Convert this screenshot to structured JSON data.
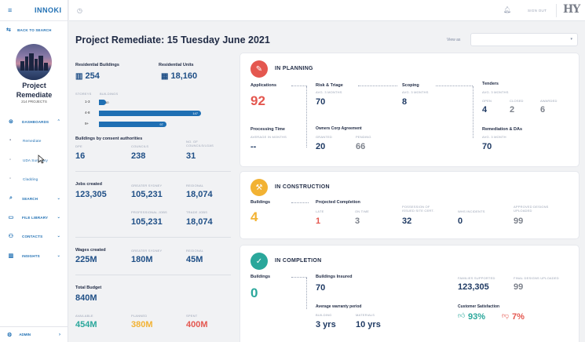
{
  "sidebar": {
    "logo_text": "INNOKI",
    "back_label": "BACK TO SEARCH",
    "project_name_line1": "Project",
    "project_name_line2": "Remediate",
    "project_count": "214 PROJECTS",
    "items": [
      {
        "label": "DASHBOARDS",
        "icon": "dashboard-icon"
      },
      {
        "label": "Remediate"
      },
      {
        "label": "UDA Summary"
      },
      {
        "label": "Cladding"
      },
      {
        "label": "SEARCH",
        "icon": "search-icon"
      },
      {
        "label": "FILE LIBRARY",
        "icon": "folder-icon"
      },
      {
        "label": "CONTACTS",
        "icon": "user-icon"
      },
      {
        "label": "INSIGHTS",
        "icon": "chart-icon"
      }
    ],
    "admin_label": "ADMIN"
  },
  "topbar": {
    "signout_label": "SIGN OUT",
    "brand_mark": "HY"
  },
  "header": {
    "title": "Project Remediate: 15 Tuesday June 2021",
    "view_as_label": "View as",
    "view_as_value": ""
  },
  "stats": {
    "res_buildings_label": "Residential Buildings",
    "res_buildings_value": "254",
    "res_units_label": "Residential Units",
    "res_units_value": "18,160",
    "storeys_label": "STOREYS",
    "buildings_label": "BUILDINGS",
    "storey_rows": [
      {
        "range": "1-3",
        "count": "10",
        "fraction": 0.07
      },
      {
        "range": "4-8",
        "count": "147",
        "fraction": 1.0
      },
      {
        "range": "9+",
        "count": "97",
        "fraction": 0.66
      }
    ],
    "by_authority_label": "Buildings by consent authorities",
    "dpe_label": "DPE",
    "dpe_value": "16",
    "councils_label": "COUNCILS",
    "councils_value": "238",
    "no_councils_label": "NO. OF COUNCILS/LGAS",
    "no_councils_value": "31",
    "jobs_label": "Jobs created",
    "jobs_value": "123,305",
    "gs_label": "GREATER SYDNEY",
    "gs_value": "105,231",
    "regional_label": "REGIONAL",
    "regional_value": "18,074",
    "prof_jobs_label": "PROFESSIONAL JOBS",
    "prof_jobs_value": "105,231",
    "trade_jobs_label": "TRADE JOBS",
    "trade_jobs_value": "18,074",
    "wages_label": "Wages created",
    "wages_value": "225M",
    "wages_gs_label": "GREATER SYDNEY",
    "wages_gs_value": "180M",
    "wages_regional_label": "REGIONAL",
    "wages_regional_value": "45M",
    "budget_label": "Total Budget",
    "budget_value": "840M",
    "available_label": "AVAILABLE",
    "available_value": "454M",
    "planned_label": "PLANNED",
    "planned_value": "380M",
    "spent_label": "SPENT",
    "spent_value": "400M"
  },
  "planning": {
    "title": "IN PLANNING",
    "applications_label": "Applications",
    "applications_value": "92",
    "risk_label": "Risk & Triage",
    "risk_sub": "AVG. 3 MONTHS",
    "risk_value": "70",
    "scoping_label": "Scoping",
    "scoping_sub": "AVG. 3 MONTHS",
    "scoping_value": "8",
    "tenders_label": "Tenders",
    "tenders_sub": "AVG. 3 MONTHS",
    "open_label": "OPEN",
    "open_value": "4",
    "closed_label": "CLOSED",
    "closed_value": "2",
    "awarded_label": "AWARDED",
    "awarded_value": "6",
    "processing_label": "Processing Time",
    "processing_sub": "AVERAGE IN MONTHS",
    "processing_value": "--",
    "owners_label": "Owners Corp Agreement",
    "granted_label": "GRANTED",
    "granted_value": "20",
    "pending_label": "PENDING",
    "pending_value": "66",
    "remediation_label": "Remediation & DAs",
    "remediation_sub": "AVG. 3 MONTH",
    "remediation_value": "70"
  },
  "construction": {
    "title": "IN CONSTRUCTION",
    "buildings_label": "Buildings",
    "buildings_value": "4",
    "completion_label": "Projected Completion",
    "late_label": "LATE",
    "late_value": "1",
    "ontime_label": "ON TIME",
    "ontime_value": "3",
    "possession_label": "POSSESSION OF ISSUED SITE CERT.",
    "possession_value": "32",
    "whs_label": "WHS INCIDENTS",
    "whs_value": "0",
    "approved_label": "APPROVED DESIGNS UPLOADED",
    "approved_value": "99"
  },
  "completion": {
    "title": "IN COMPLETION",
    "buildings_label": "Buildings",
    "buildings_value": "0",
    "insured_label": "Buildings Insured",
    "insured_value": "70",
    "warranty_label": "Average warranty period",
    "building_label": "BUILDING",
    "building_value": "3 yrs",
    "materials_label": "MATERIALS",
    "materials_value": "10 yrs",
    "families_label": "FAMILIES SUPPORTED",
    "families_value": "123,305",
    "final_label": "FINAL DESIGNS UPLOADED",
    "final_value": "99",
    "satisfaction_label": "Customer Satisfaction",
    "positive_value": "93%",
    "negative_value": "7%"
  }
}
